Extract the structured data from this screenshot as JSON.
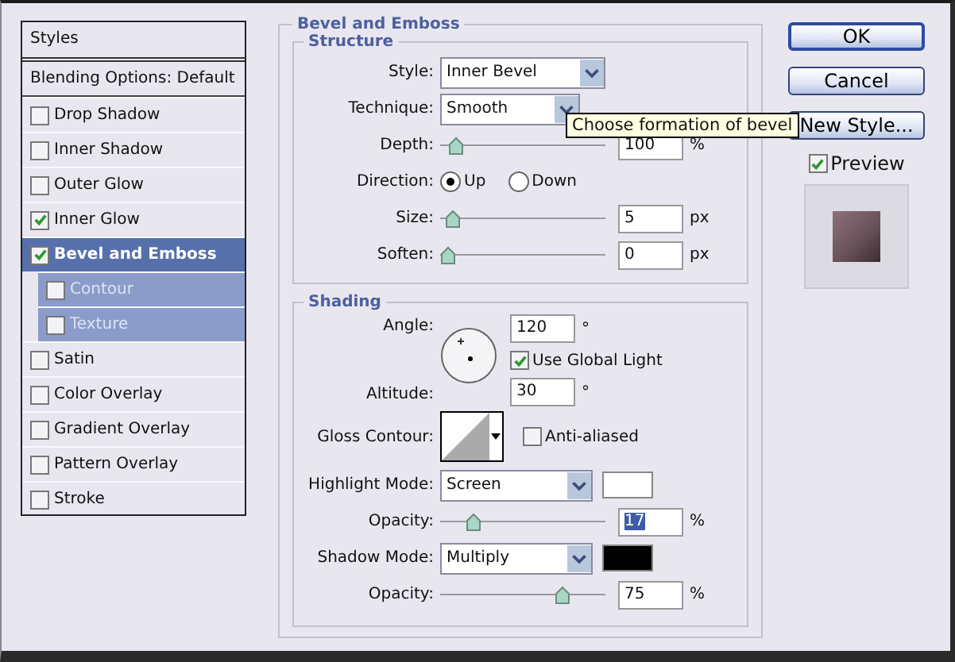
{
  "styles_panel": {
    "header": "Styles",
    "items": [
      {
        "label": "Blending Options: Default",
        "kind": "plain",
        "selected": false
      },
      {
        "label": "Drop Shadow",
        "kind": "check",
        "checked": false,
        "selected": false
      },
      {
        "label": "Inner Shadow",
        "kind": "check",
        "checked": false,
        "selected": false
      },
      {
        "label": "Outer Glow",
        "kind": "check",
        "checked": false,
        "selected": false
      },
      {
        "label": "Inner Glow",
        "kind": "check",
        "checked": true,
        "selected": false
      },
      {
        "label": "Bevel and Emboss",
        "kind": "check",
        "checked": true,
        "selected": true,
        "children": [
          {
            "label": "Contour",
            "checked": false
          },
          {
            "label": "Texture",
            "checked": false
          }
        ]
      },
      {
        "label": "Satin",
        "kind": "check",
        "checked": false,
        "selected": false
      },
      {
        "label": "Color Overlay",
        "kind": "check",
        "checked": false,
        "selected": false
      },
      {
        "label": "Gradient Overlay",
        "kind": "check",
        "checked": false,
        "selected": false
      },
      {
        "label": "Pattern Overlay",
        "kind": "check",
        "checked": false,
        "selected": false
      },
      {
        "label": "Stroke",
        "kind": "check",
        "checked": false,
        "selected": false
      }
    ]
  },
  "settings": {
    "title": "Bevel and Emboss",
    "structure": {
      "title": "Structure",
      "style": {
        "label": "Style:",
        "value": "Inner Bevel"
      },
      "technique": {
        "label": "Technique:",
        "value": "Smooth"
      },
      "tooltip": "Choose formation of bevel",
      "depth": {
        "label": "Depth:",
        "level": 0.05,
        "value": "100",
        "unit": "%"
      },
      "direction": {
        "label": "Direction:",
        "options": [
          {
            "label": "Up",
            "selected": true
          },
          {
            "label": "Down",
            "selected": false
          }
        ]
      },
      "size": {
        "label": "Size:",
        "level": 0.03,
        "value": "5",
        "unit": "px"
      },
      "soften": {
        "label": "Soften:",
        "level": 0,
        "value": "0",
        "unit": "px"
      }
    },
    "shading": {
      "title": "Shading",
      "angle": {
        "label": "Angle:",
        "value": "120",
        "unit": "°"
      },
      "use_global_light": {
        "label": "Use Global Light",
        "checked": true
      },
      "altitude": {
        "label": "Altitude:",
        "value": "30",
        "unit": "°"
      },
      "gloss_contour": {
        "label": "Gloss Contour:"
      },
      "anti_aliased": {
        "label": "Anti-aliased",
        "checked": false
      },
      "highlight_mode": {
        "label": "Highlight Mode:",
        "value": "Screen",
        "color": "#ffffff"
      },
      "highlight_opacity": {
        "label": "Opacity:",
        "level": 0.17,
        "value": "17",
        "unit": "%",
        "selected": true
      },
      "shadow_mode": {
        "label": "Shadow Mode:",
        "value": "Multiply",
        "color": "#000000"
      },
      "shadow_opacity": {
        "label": "Opacity:",
        "level": 0.75,
        "value": "75",
        "unit": "%",
        "selected": false
      }
    }
  },
  "buttons": [
    {
      "label": "OK",
      "default": true
    },
    {
      "label": "Cancel",
      "default": false
    },
    {
      "label": "New Style...",
      "default": false
    }
  ],
  "preview": {
    "label": "Preview",
    "checked": true
  }
}
